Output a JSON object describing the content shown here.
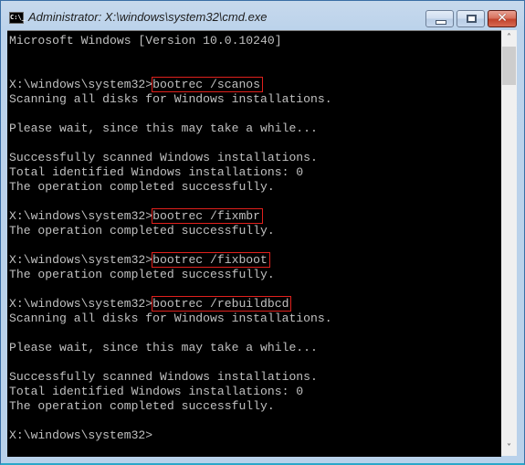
{
  "window": {
    "title": "Administrator: X:\\windows\\system32\\cmd.exe",
    "icon_label": "C:\\_",
    "controls": {
      "minimize": "minimize-icon",
      "maximize": "maximize-icon",
      "close": "✕"
    }
  },
  "console": {
    "lines": [
      {
        "prompt": "Microsoft Windows [Version 10.0.10240]",
        "cmd": ""
      },
      {
        "prompt": "",
        "cmd": ""
      },
      {
        "prompt": "",
        "cmd": ""
      },
      {
        "prompt": "X:\\windows\\system32>",
        "cmd": "bootrec /scanos"
      },
      {
        "prompt": "Scanning all disks for Windows installations.",
        "cmd": ""
      },
      {
        "prompt": "",
        "cmd": ""
      },
      {
        "prompt": "Please wait, since this may take a while...",
        "cmd": ""
      },
      {
        "prompt": "",
        "cmd": ""
      },
      {
        "prompt": "Successfully scanned Windows installations.",
        "cmd": ""
      },
      {
        "prompt": "Total identified Windows installations: 0",
        "cmd": ""
      },
      {
        "prompt": "The operation completed successfully.",
        "cmd": ""
      },
      {
        "prompt": "",
        "cmd": ""
      },
      {
        "prompt": "X:\\windows\\system32>",
        "cmd": "bootrec /fixmbr"
      },
      {
        "prompt": "The operation completed successfully.",
        "cmd": ""
      },
      {
        "prompt": "",
        "cmd": ""
      },
      {
        "prompt": "X:\\windows\\system32>",
        "cmd": "bootrec /fixboot"
      },
      {
        "prompt": "The operation completed successfully.",
        "cmd": ""
      },
      {
        "prompt": "",
        "cmd": ""
      },
      {
        "prompt": "X:\\windows\\system32>",
        "cmd": "bootrec /rebuildbcd"
      },
      {
        "prompt": "Scanning all disks for Windows installations.",
        "cmd": ""
      },
      {
        "prompt": "",
        "cmd": ""
      },
      {
        "prompt": "Please wait, since this may take a while...",
        "cmd": ""
      },
      {
        "prompt": "",
        "cmd": ""
      },
      {
        "prompt": "Successfully scanned Windows installations.",
        "cmd": ""
      },
      {
        "prompt": "Total identified Windows installations: 0",
        "cmd": ""
      },
      {
        "prompt": "The operation completed successfully.",
        "cmd": ""
      },
      {
        "prompt": "",
        "cmd": ""
      },
      {
        "prompt": "X:\\windows\\system32>",
        "cmd": ""
      }
    ],
    "highlight_color": "#e0201c",
    "text_color": "#c0c0c0",
    "background_color": "#000000"
  },
  "scrollbar": {
    "up": "^",
    "down": "v",
    "position_fraction": 0
  }
}
